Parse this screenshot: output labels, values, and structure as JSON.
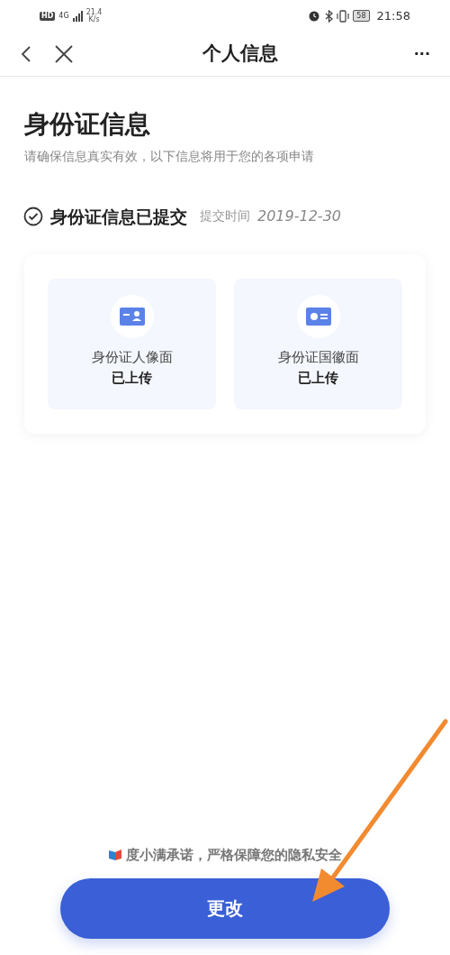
{
  "status_bar": {
    "hd": "HD",
    "network": "4G",
    "speed_value": "21.4",
    "speed_unit": "K/s",
    "battery": "58",
    "time": "21:58"
  },
  "header": {
    "title": "个人信息",
    "more": "···"
  },
  "page": {
    "title": "身份证信息",
    "subtitle": "请确保信息真实有效，以下信息将用于您的各项申请"
  },
  "submission": {
    "status": "身份证信息已提交",
    "time_label": "提交时间",
    "date": "2019-12-30"
  },
  "documents": [
    {
      "kind": "portrait",
      "label": "身份证人像面",
      "status": "已上传"
    },
    {
      "kind": "emblem",
      "label": "身份证国徽面",
      "status": "已上传"
    }
  ],
  "footer": {
    "promise": "度小满承诺，严格保障您的隐私安全",
    "button": "更改"
  }
}
